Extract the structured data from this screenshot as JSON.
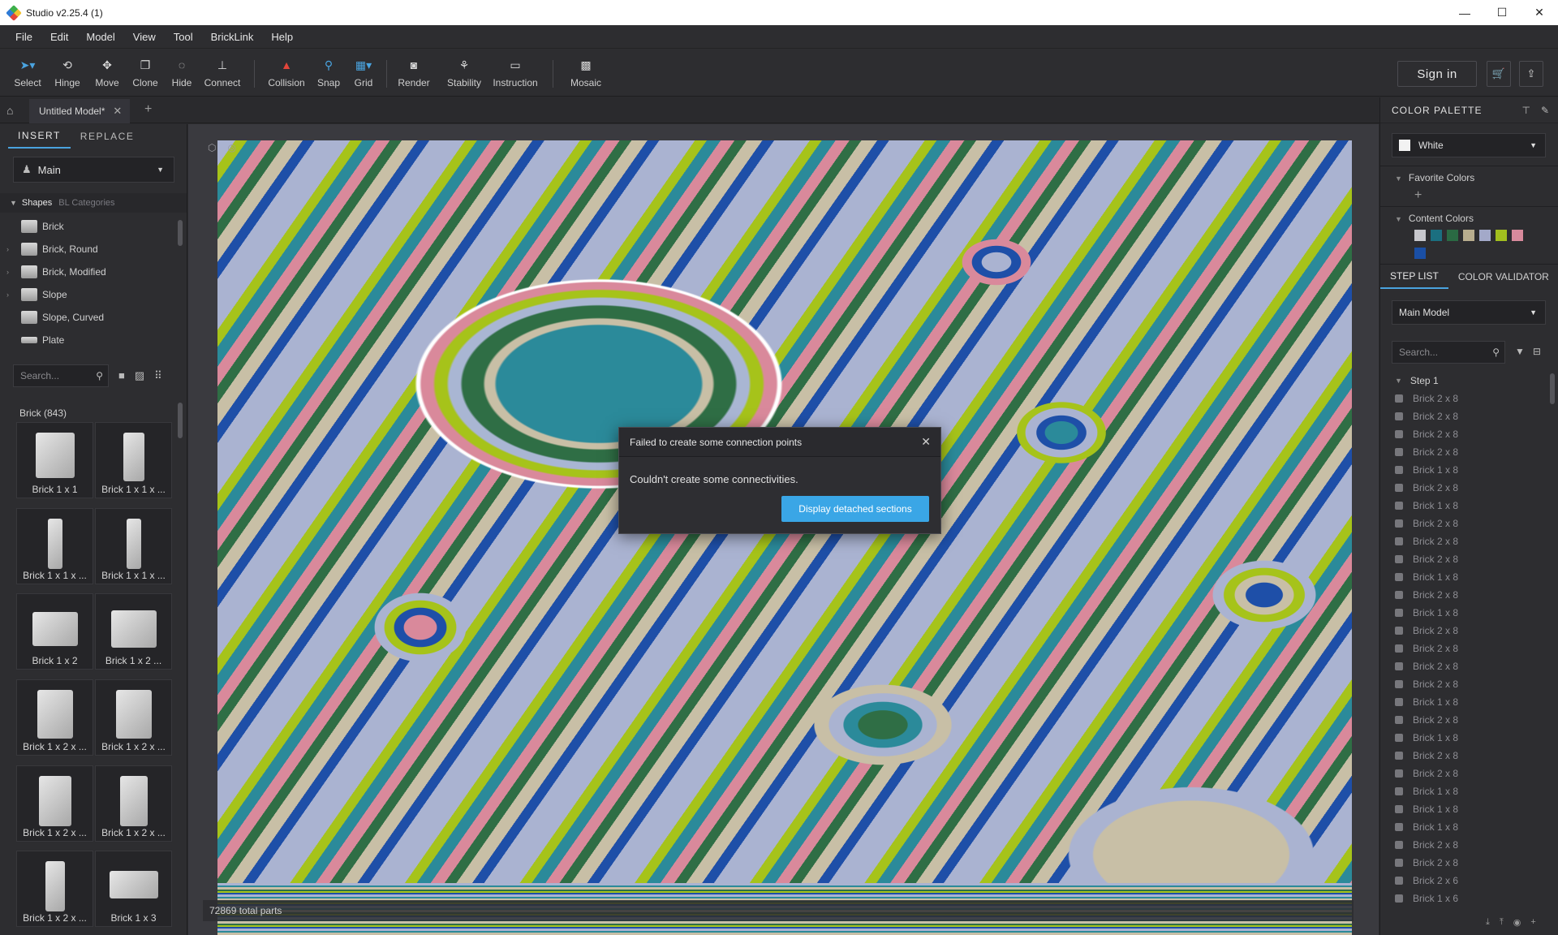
{
  "window": {
    "title": "Studio v2.25.4 (1)",
    "minimize": "—",
    "maximize": "☐",
    "close": "✕"
  },
  "menu": [
    "File",
    "Edit",
    "Model",
    "View",
    "Tool",
    "BrickLink",
    "Help"
  ],
  "toolbar": {
    "tools": [
      {
        "label": "Select",
        "icon": "cursor-icon"
      },
      {
        "label": "Hinge",
        "icon": "hinge-icon"
      },
      {
        "label": "Move",
        "icon": "move-icon"
      },
      {
        "label": "Clone",
        "icon": "clone-icon"
      },
      {
        "label": "Hide",
        "icon": "hide-icon"
      },
      {
        "label": "Connect",
        "icon": "connect-icon"
      },
      {
        "label": "Collision",
        "icon": "collision-icon"
      },
      {
        "label": "Snap",
        "icon": "snap-icon"
      },
      {
        "label": "Grid",
        "icon": "grid-icon"
      },
      {
        "label": "Render",
        "icon": "camera-icon"
      },
      {
        "label": "Stability",
        "icon": "stability-icon"
      },
      {
        "label": "Instruction",
        "icon": "instruction-icon"
      },
      {
        "label": "Mosaic",
        "icon": "mosaic-icon"
      }
    ],
    "sign_in": "Sign in"
  },
  "tabs": {
    "document": "Untitled Model*",
    "close": "✕",
    "add": "+"
  },
  "left": {
    "tabs": [
      "INSERT",
      "REPLACE"
    ],
    "palette_select": "Main",
    "shape_tabs": [
      "Shapes",
      "BL Categories"
    ],
    "categories": [
      "Brick",
      "Brick, Round",
      "Brick, Modified",
      "Slope",
      "Slope, Curved",
      "Plate"
    ],
    "search_placeholder": "Search...",
    "parts_header": "Brick (843)",
    "parts": [
      "Brick 1 x 1",
      "Brick 1 x 1 x ...",
      "Brick 1 x 1 x ...",
      "Brick 1 x 1 x ...",
      "Brick 1 x 2",
      "Brick 1 x 2 ...",
      "Brick 1 x 2 x ...",
      "Brick 1 x 2 x ...",
      "Brick 1 x 2 x ...",
      "Brick 1 x 2 x ...",
      "Brick 1 x 2 x ...",
      "Brick 1 x 3"
    ]
  },
  "viewport": {
    "status": "72869 total parts"
  },
  "dialog": {
    "title": "Failed to create some connection points",
    "message": "Couldn't create some connectivities.",
    "button": "Display detached sections"
  },
  "right": {
    "palette_title": "COLOR PALETTE",
    "selected_color": "White",
    "favorite_title": "Favorite Colors",
    "content_title": "Content Colors",
    "content_colors": [
      "#c7c7cc",
      "#1b6f80",
      "#2a6a43",
      "#b8ad8e",
      "#a3a9c9",
      "#a2bf1e",
      "#d88a9c",
      "#1a4fa5"
    ],
    "step_tabs": [
      "STEP LIST",
      "COLOR VALIDATOR"
    ],
    "model_select": "Main Model",
    "search_placeholder": "Search...",
    "step_title": "Step 1",
    "steps": [
      "Brick 2 x 8",
      "Brick 2 x 8",
      "Brick 2 x 8",
      "Brick 2 x 8",
      "Brick 1 x 8",
      "Brick 2 x 8",
      "Brick 1 x 8",
      "Brick 2 x 8",
      "Brick 2 x 8",
      "Brick 2 x 8",
      "Brick 1 x 8",
      "Brick 2 x 8",
      "Brick 1 x 8",
      "Brick 2 x 8",
      "Brick 2 x 8",
      "Brick 2 x 8",
      "Brick 2 x 8",
      "Brick 1 x 8",
      "Brick 2 x 8",
      "Brick 1 x 8",
      "Brick 2 x 8",
      "Brick 2 x 8",
      "Brick 1 x 8",
      "Brick 1 x 8",
      "Brick 1 x 8",
      "Brick 2 x 8",
      "Brick 2 x 8",
      "Brick 2 x 6",
      "Brick 1 x 6"
    ]
  }
}
